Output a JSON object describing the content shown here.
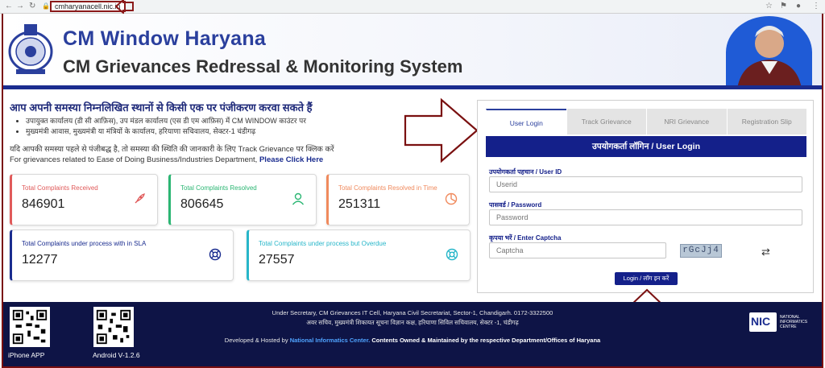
{
  "browser": {
    "url": "cmharyanacell.nic.in"
  },
  "header": {
    "title": "CM Window Haryana",
    "subtitle": "CM Grievances Redressal & Monitoring System"
  },
  "registration": {
    "heading": "आप अपनी समस्या निम्नलिखित स्थानों से किसी एक पर पंजीकरण करवा सकते हैं",
    "items": [
      "उपायुक्त कार्यालय (डी सी आफ़िस), उप मंडल कार्यालय (एस डी एम आफ़िस) में CM WINDOW काउंटर पर",
      "मुख्यमंत्री आवास, मुख्यमंत्री या मंत्रियों के कार्यालय, हरियाणा सचिवालय, सेक्टर-1 चंडीगढ़"
    ],
    "info_track": "यदि आपकी समस्या पहले से पंजीबद्ध है, तो समस्या की स्थिति की जानकारी के लिए Track Grievance पर क्लिक करें",
    "info_business": "For grievances related to Ease of Doing Business/Industries Department,",
    "info_business_link": "Please Click Here"
  },
  "stats": [
    {
      "label": "Total Complaints Received",
      "value": "846901",
      "color": "#e05a5a",
      "icon": "rocket-icon"
    },
    {
      "label": "Total Complaints Resolved",
      "value": "806645",
      "color": "#2bb673",
      "icon": "user-icon"
    },
    {
      "label": "Total Complaints Resolved in Time",
      "value": "251311",
      "color": "#f08a5d",
      "icon": "pie-chart-icon"
    },
    {
      "label": "Total Complaints under process with in SLA",
      "value": "12277",
      "color": "#1a2c8f",
      "icon": "lifebuoy-icon"
    },
    {
      "label": "Total Complaints under process but Overdue",
      "value": "27557",
      "color": "#27b6c9",
      "icon": "lifebuoy-icon"
    }
  ],
  "login": {
    "tabs": [
      "User Login",
      "Track Grievance",
      "NRI Grievance",
      "Registration Slip"
    ],
    "heading": "उपयोगकर्ता लॉगिन / User Login",
    "userid_label": "उपयोगकर्ता पहचान / User ID",
    "userid_placeholder": "Userid",
    "password_label": "पासवर्ड / Password",
    "password_placeholder": "Password",
    "captcha_label": "कृपया भरें / Enter Captcha",
    "captcha_placeholder": "Captcha",
    "captcha_text": "rGcJj4",
    "button": "Login / लॉग इन करें"
  },
  "footer": {
    "qr1_label": "iPhone APP",
    "qr2_label": "Android V-1.2.6",
    "line1": "Under Secretary, CM Grievances IT Cell, Haryana Civil Secretariat, Sector-1, Chandigarh. 0172-3322500",
    "line2": "अवर सचिव, मुख्यमंत्री शिकायत सूचना विज्ञान कक्ष, हरियाणा सिविल सचिवालय, सेक्टर -1, चंडीगढ़",
    "dev_prefix": "Developed & Hosted by",
    "dev_nic": "National Informatics Center.",
    "dev_suffix": "Contents Owned & Maintained by the respective Department/Offices of Haryana",
    "nic_abbr": "NIC",
    "nic_full": "NATIONAL INFORMATICS CENTRE"
  }
}
